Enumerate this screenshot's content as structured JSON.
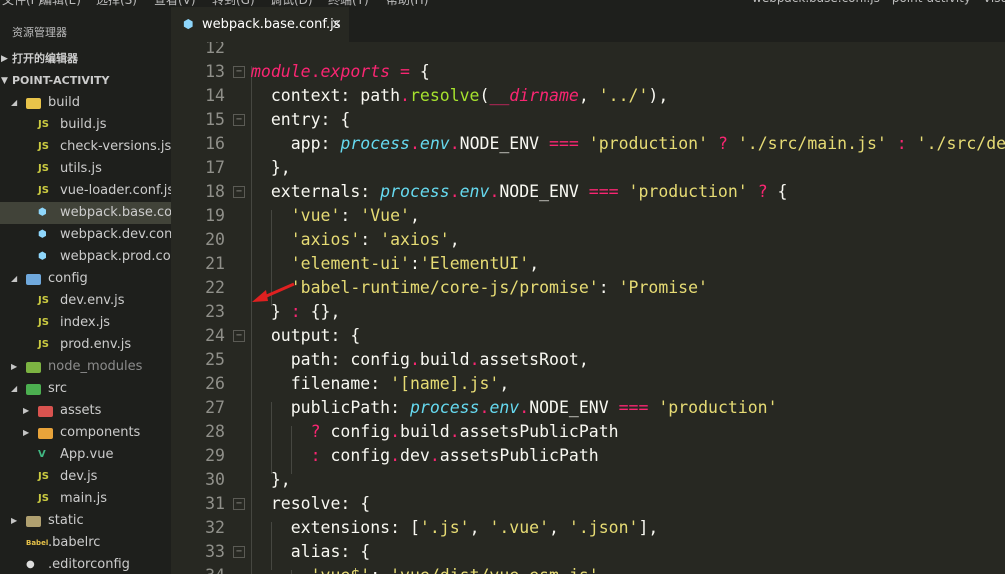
{
  "menubar": {
    "items": [
      "文件(F)",
      "编辑(E)",
      "选择(S)",
      "查看(V)",
      "转到(G)",
      "调试(D)",
      "终端(T)",
      "帮助(H)"
    ],
    "window_title": "webpack.base.conf.js - point-activity - Visual Studio Code"
  },
  "sidebar": {
    "title": "资源管理器",
    "open_editors": "打开的编辑器",
    "project": "POINT-ACTIVITY",
    "tree": [
      {
        "label": "build",
        "icon": "folder-build-icon",
        "depth": 1,
        "twisty": "open"
      },
      {
        "label": "build.js",
        "icon": "JS",
        "depth": 2
      },
      {
        "label": "check-versions.js",
        "icon": "JS",
        "depth": 2
      },
      {
        "label": "utils.js",
        "icon": "JS",
        "depth": 2
      },
      {
        "label": "vue-loader.conf.js",
        "icon": "JS",
        "depth": 2
      },
      {
        "label": "webpack.base.co...",
        "icon": "webpack-icon",
        "depth": 2,
        "selected": true
      },
      {
        "label": "webpack.dev.con...",
        "icon": "webpack-icon",
        "depth": 2
      },
      {
        "label": "webpack.prod.co...",
        "icon": "webpack-icon",
        "depth": 2
      },
      {
        "label": "config",
        "icon": "folder-config-icon",
        "depth": 1,
        "twisty": "open"
      },
      {
        "label": "dev.env.js",
        "icon": "JS",
        "depth": 2
      },
      {
        "label": "index.js",
        "icon": "JS",
        "depth": 2
      },
      {
        "label": "prod.env.js",
        "icon": "JS",
        "depth": 2
      },
      {
        "label": "node_modules",
        "icon": "folder-node-icon",
        "depth": 1,
        "twisty": "closed",
        "dim": true
      },
      {
        "label": "src",
        "icon": "folder-src-icon",
        "depth": 1,
        "twisty": "open"
      },
      {
        "label": "assets",
        "icon": "folder-assets-icon",
        "depth": 2,
        "twisty": "closed"
      },
      {
        "label": "components",
        "icon": "folder-components-icon",
        "depth": 2,
        "twisty": "closed"
      },
      {
        "label": "App.vue",
        "icon": "vue-icon",
        "depth": 2
      },
      {
        "label": "dev.js",
        "icon": "JS",
        "depth": 2
      },
      {
        "label": "main.js",
        "icon": "JS",
        "depth": 2
      },
      {
        "label": "static",
        "icon": "folder-static-icon",
        "depth": 1,
        "twisty": "closed"
      },
      {
        "label": ".babelrc",
        "icon": "babel-icon",
        "depth": 1
      },
      {
        "label": ".editorconfig",
        "icon": "editorconfig-icon",
        "depth": 1
      }
    ]
  },
  "tab": {
    "label": "webpack.base.conf.js",
    "close": "×"
  },
  "editor": {
    "lines": [
      {
        "n": "12",
        "tokens": []
      },
      {
        "n": "13",
        "fold": true,
        "tokens": [
          [
            "k",
            "module"
          ],
          [
            "p",
            "."
          ],
          [
            "k",
            "exports"
          ],
          [
            "",
            " "
          ],
          [
            "p",
            "="
          ],
          [
            "",
            " {"
          ]
        ]
      },
      {
        "n": "14",
        "tokens": [
          [
            "",
            "  context: path"
          ],
          [
            "p",
            "."
          ],
          [
            "f",
            "resolve"
          ],
          [
            "",
            "("
          ],
          [
            "k",
            "__dirname"
          ],
          [
            "",
            ", "
          ],
          [
            "s",
            "'../'"
          ],
          [
            "",
            "),"
          ]
        ]
      },
      {
        "n": "15",
        "fold": true,
        "tokens": [
          [
            "",
            "  entry: {"
          ]
        ]
      },
      {
        "n": "16",
        "tokens": [
          [
            "",
            "    app: "
          ],
          [
            "i",
            "process"
          ],
          [
            "p",
            "."
          ],
          [
            "i",
            "env"
          ],
          [
            "p",
            "."
          ],
          [
            "",
            "NODE_ENV "
          ],
          [
            "p",
            "==="
          ],
          [
            "",
            " "
          ],
          [
            "s",
            "'production'"
          ],
          [
            "",
            " "
          ],
          [
            "p",
            "?"
          ],
          [
            "",
            " "
          ],
          [
            "s",
            "'./src/main.js'"
          ],
          [
            "",
            " "
          ],
          [
            "p",
            ":"
          ],
          [
            "",
            " "
          ],
          [
            "s",
            "'./src/dev.js'"
          ]
        ]
      },
      {
        "n": "17",
        "tokens": [
          [
            "",
            "  },"
          ]
        ]
      },
      {
        "n": "18",
        "fold": true,
        "tokens": [
          [
            "",
            "  externals: "
          ],
          [
            "i",
            "process"
          ],
          [
            "p",
            "."
          ],
          [
            "i",
            "env"
          ],
          [
            "p",
            "."
          ],
          [
            "",
            "NODE_ENV "
          ],
          [
            "p",
            "==="
          ],
          [
            "",
            " "
          ],
          [
            "s",
            "'production'"
          ],
          [
            "",
            " "
          ],
          [
            "p",
            "?"
          ],
          [
            "",
            " {"
          ]
        ]
      },
      {
        "n": "19",
        "tokens": [
          [
            "",
            "    "
          ],
          [
            "s",
            "'vue'"
          ],
          [
            "",
            ": "
          ],
          [
            "s",
            "'Vue'"
          ],
          [
            "",
            ","
          ]
        ]
      },
      {
        "n": "20",
        "tokens": [
          [
            "",
            "    "
          ],
          [
            "s",
            "'axios'"
          ],
          [
            "",
            ": "
          ],
          [
            "s",
            "'axios'"
          ],
          [
            "",
            ","
          ]
        ]
      },
      {
        "n": "21",
        "tokens": [
          [
            "",
            "    "
          ],
          [
            "s",
            "'element-ui'"
          ],
          [
            "",
            ":"
          ],
          [
            "s",
            "'ElementUI'"
          ],
          [
            "",
            ","
          ]
        ]
      },
      {
        "n": "22",
        "tokens": [
          [
            "",
            "    "
          ],
          [
            "s",
            "'babel-runtime/core-js/promise'"
          ],
          [
            "",
            ": "
          ],
          [
            "s",
            "'Promise'"
          ]
        ]
      },
      {
        "n": "23",
        "tokens": [
          [
            "",
            "  } "
          ],
          [
            "p",
            ":"
          ],
          [
            "",
            " {},"
          ]
        ]
      },
      {
        "n": "24",
        "fold": true,
        "tokens": [
          [
            "",
            "  output: {"
          ]
        ]
      },
      {
        "n": "25",
        "tokens": [
          [
            "",
            "    path: config"
          ],
          [
            "p",
            "."
          ],
          [
            "",
            "build"
          ],
          [
            "p",
            "."
          ],
          [
            "",
            "assetsRoot,"
          ]
        ]
      },
      {
        "n": "26",
        "tokens": [
          [
            "",
            "    filename: "
          ],
          [
            "s",
            "'[name].js'"
          ],
          [
            "",
            ","
          ]
        ]
      },
      {
        "n": "27",
        "tokens": [
          [
            "",
            "    publicPath: "
          ],
          [
            "i",
            "process"
          ],
          [
            "p",
            "."
          ],
          [
            "i",
            "env"
          ],
          [
            "p",
            "."
          ],
          [
            "",
            "NODE_ENV "
          ],
          [
            "p",
            "==="
          ],
          [
            "",
            " "
          ],
          [
            "s",
            "'production'"
          ]
        ]
      },
      {
        "n": "28",
        "tokens": [
          [
            "",
            "      "
          ],
          [
            "p",
            "?"
          ],
          [
            "",
            " config"
          ],
          [
            "p",
            "."
          ],
          [
            "",
            "build"
          ],
          [
            "p",
            "."
          ],
          [
            "",
            "assetsPublicPath"
          ]
        ]
      },
      {
        "n": "29",
        "tokens": [
          [
            "",
            "      "
          ],
          [
            "p",
            ":"
          ],
          [
            "",
            " config"
          ],
          [
            "p",
            "."
          ],
          [
            "",
            "dev"
          ],
          [
            "p",
            "."
          ],
          [
            "",
            "assetsPublicPath"
          ]
        ]
      },
      {
        "n": "30",
        "tokens": [
          [
            "",
            "  },"
          ]
        ]
      },
      {
        "n": "31",
        "fold": true,
        "tokens": [
          [
            "",
            "  resolve: {"
          ]
        ]
      },
      {
        "n": "32",
        "tokens": [
          [
            "",
            "    extensions: ["
          ],
          [
            "s",
            "'.js'"
          ],
          [
            "",
            ", "
          ],
          [
            "s",
            "'.vue'"
          ],
          [
            "",
            ", "
          ],
          [
            "s",
            "'.json'"
          ],
          [
            "",
            "],"
          ]
        ]
      },
      {
        "n": "33",
        "fold": true,
        "tokens": [
          [
            "",
            "    alias: {"
          ]
        ]
      },
      {
        "n": "34",
        "tokens": [
          [
            "",
            "      "
          ],
          [
            "s",
            "'vue$'"
          ],
          [
            "",
            ": "
          ],
          [
            "s",
            "'vue/dist/vue.esm.js'"
          ],
          [
            "",
            ","
          ]
        ]
      }
    ]
  }
}
